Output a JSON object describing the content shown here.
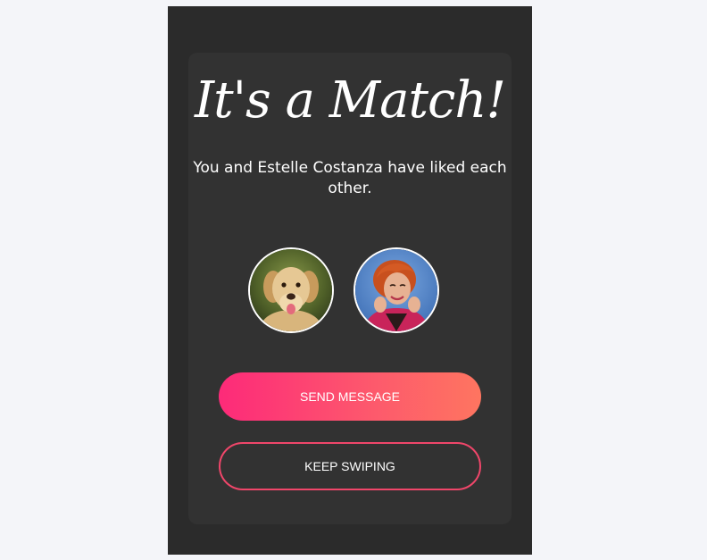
{
  "match": {
    "title": "It's a Match!",
    "subtitle": "You and Estelle Costanza have liked each other."
  },
  "avatars": {
    "left": {
      "icon": "dog-photo-avatar"
    },
    "right": {
      "icon": "woman-photo-avatar"
    }
  },
  "buttons": {
    "send_message": "SEND MESSAGE",
    "keep_swiping": "KEEP SWIPING"
  },
  "colors": {
    "background": "#2b2b2b",
    "page": "#f4f5f9",
    "gradient_start": "#fd2a79",
    "gradient_end": "#fe7560",
    "outline": "#f0466a"
  }
}
